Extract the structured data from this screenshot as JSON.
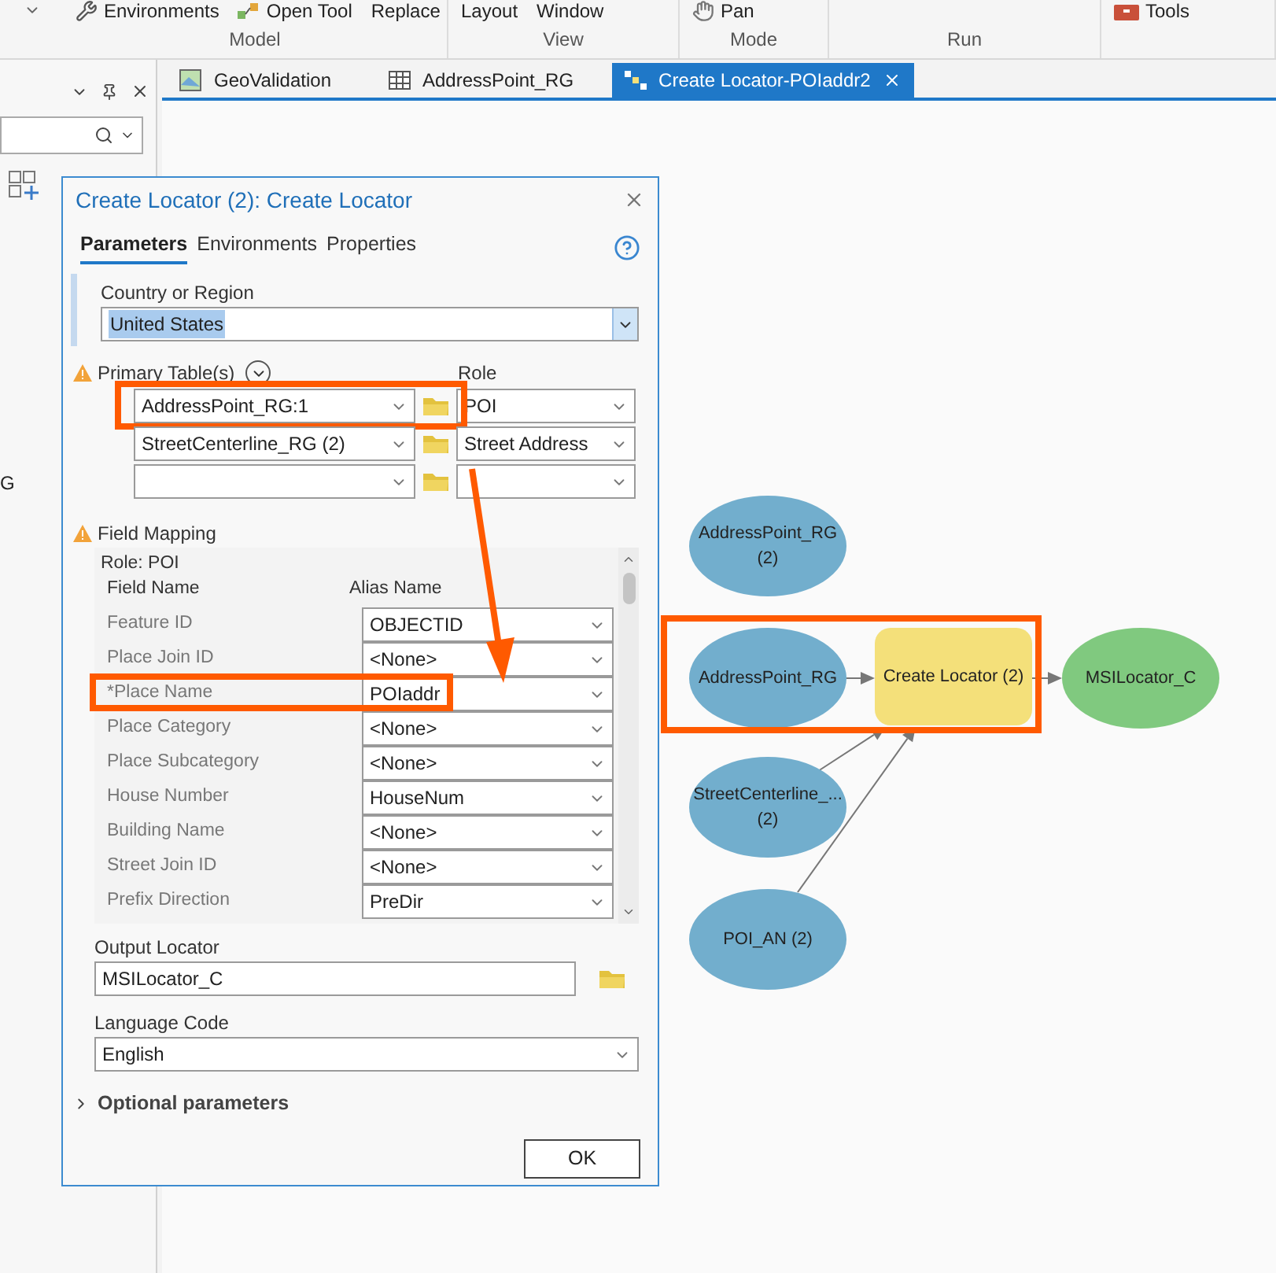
{
  "ribbon": {
    "groups": [
      {
        "label": "Model",
        "items": [
          {
            "label": "Environments",
            "kind": "tools"
          },
          {
            "label": "Open Tool",
            "kind": "open"
          },
          {
            "label": "Replace",
            "kind": "plain"
          }
        ]
      },
      {
        "label": "View",
        "items": [
          {
            "label": "Layout",
            "kind": "plain"
          },
          {
            "label": "Window",
            "kind": "plain"
          }
        ]
      },
      {
        "label": "Mode",
        "items": [
          {
            "label": "Pan",
            "kind": "pan"
          }
        ]
      },
      {
        "label": "Run"
      },
      {
        "items": [
          {
            "label": "Tools",
            "kind": "toolbox"
          }
        ]
      }
    ]
  },
  "side_pane": {
    "partial_text": "G"
  },
  "doc_tabs": [
    {
      "label": "GeoValidation",
      "kind": "map",
      "selected": false
    },
    {
      "label": "AddressPoint_RG",
      "kind": "table",
      "selected": false
    },
    {
      "label": "Create Locator-POIaddr2",
      "kind": "model",
      "selected": true
    }
  ],
  "dialog": {
    "title": "Create Locator (2): Create Locator",
    "tabs": [
      {
        "label": "Parameters",
        "selected": true
      },
      {
        "label": "Environments",
        "selected": false
      },
      {
        "label": "Properties",
        "selected": false
      }
    ],
    "country": {
      "label": "Country or Region",
      "value": "United States"
    },
    "primary_tables": {
      "label": "Primary Table(s)",
      "role_label": "Role",
      "warning": true,
      "rows": [
        {
          "table": "AddressPoint_RG:1",
          "role": "POI",
          "highlighted": true
        },
        {
          "table": "StreetCenterline_RG (2)",
          "role": "Street Address",
          "highlighted": false
        },
        {
          "highlighted": false
        }
      ]
    },
    "field_mapping": {
      "label": "Field Mapping",
      "warning": true,
      "role": "Role: POI",
      "columns": [
        "Field Name",
        "Alias Name"
      ],
      "rows": [
        {
          "field": "Feature ID",
          "alias": "OBJECTID",
          "highlighted": false
        },
        {
          "field": "Place Join ID",
          "alias": "<None>",
          "highlighted": false
        },
        {
          "field": "*Place Name",
          "alias": "POIaddr",
          "highlighted": true
        },
        {
          "field": "Place Category",
          "alias": "<None>",
          "highlighted": false
        },
        {
          "field": "Place Subcategory",
          "alias": "<None>",
          "highlighted": false
        },
        {
          "field": "House Number",
          "alias": "HouseNum",
          "highlighted": false
        },
        {
          "field": "Building Name",
          "alias": "<None>",
          "highlighted": false
        },
        {
          "field": "Street Join ID",
          "alias": "<None>",
          "highlighted": false
        },
        {
          "field": "Prefix Direction",
          "alias": "PreDir",
          "highlighted": false
        }
      ]
    },
    "output_locator": {
      "label": "Output Locator",
      "value": "MSILocator_C"
    },
    "language_code": {
      "label": "Language Code",
      "value": "English"
    },
    "optional": {
      "label": "Optional parameters",
      "expanded": false
    },
    "ok_button": "OK"
  },
  "model": {
    "highlight_frame": true,
    "nodes": [
      {
        "label": "AddressPoint_RG",
        "sub": "(2)",
        "kind": "data"
      },
      {
        "label": "AddressPoint_RG",
        "kind": "data"
      },
      {
        "label": "Create Locator (2)",
        "kind": "tool"
      },
      {
        "label": "MSILocator_C",
        "kind": "output"
      },
      {
        "label": "StreetCenterline_...",
        "sub": "(2)",
        "kind": "data"
      },
      {
        "label": "POI_AN (2)",
        "kind": "data"
      }
    ]
  }
}
